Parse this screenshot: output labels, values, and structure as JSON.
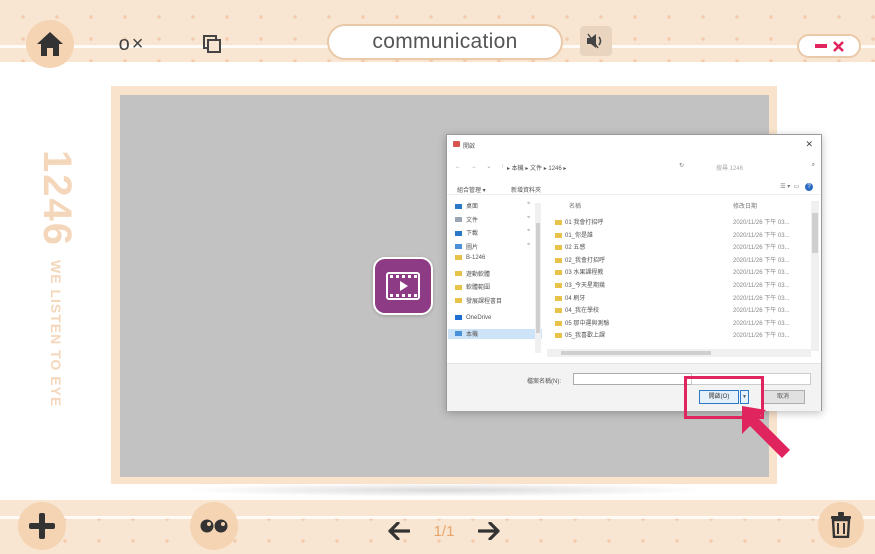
{
  "header": {
    "title": "communication",
    "quiz_toggle_label": "o×",
    "colors": {
      "accent": "#e6a56b",
      "bar": "#f8e6d3",
      "close": "#e0245e"
    }
  },
  "side_watermark": {
    "number": "1246",
    "subtitle": "WE LISTEN TO EYE"
  },
  "dialog": {
    "title": "開啟",
    "path": "▸ 本機 ▸ 文件 ▸ 1246 ▸",
    "search_placeholder": "搜尋 1246",
    "toolbar": {
      "organize": "組合管理 ▾",
      "new_folder": "新增資料夾"
    },
    "nav_items": [
      {
        "label": "桌面",
        "color": "#2b78c8"
      },
      {
        "label": "文件",
        "color": "#9aa6b2"
      },
      {
        "label": "下載",
        "color": "#2b78c8"
      },
      {
        "label": "圖片",
        "color": "#4a90d9"
      },
      {
        "label": "B-1246",
        "color": "#e8c34a"
      },
      {
        "label": "遊動軟體",
        "color": "#e8c34a"
      },
      {
        "label": "軟體範圍",
        "color": "#e8c34a"
      },
      {
        "label": "發展課程書目",
        "color": "#e8c34a"
      },
      {
        "label": "OneDrive",
        "color": "#1e6fd1"
      },
      {
        "label": "本機",
        "color": "#4a90d9"
      }
    ],
    "columns": {
      "name": "名稱",
      "date": "修改日期"
    },
    "files": [
      {
        "name": "01 我會打招呼",
        "date": "2020/11/26 下午 03..."
      },
      {
        "name": "01_你是誰",
        "date": "2020/11/26 下午 03..."
      },
      {
        "name": "02 五感",
        "date": "2020/11/26 下午 03..."
      },
      {
        "name": "02_我會打招呼",
        "date": "2020/11/26 下午 03..."
      },
      {
        "name": "03 水果課程教",
        "date": "2020/11/26 下午 03..."
      },
      {
        "name": "03_今天星期幾",
        "date": "2020/11/26 下午 03..."
      },
      {
        "name": "04 刷牙",
        "date": "2020/11/26 下午 03..."
      },
      {
        "name": "04_我在學校",
        "date": "2020/11/26 下午 03..."
      },
      {
        "name": "05 那中運與測驗",
        "date": "2020/11/26 下午 03..."
      },
      {
        "name": "05_我喜歡上課",
        "date": "2020/11/26 下午 03..."
      }
    ],
    "filename_label": "檔案名稱(N):",
    "filetype_value": "",
    "open_button": "開啟(O)",
    "cancel_button": "取消"
  },
  "pager": {
    "current": "1/1"
  }
}
